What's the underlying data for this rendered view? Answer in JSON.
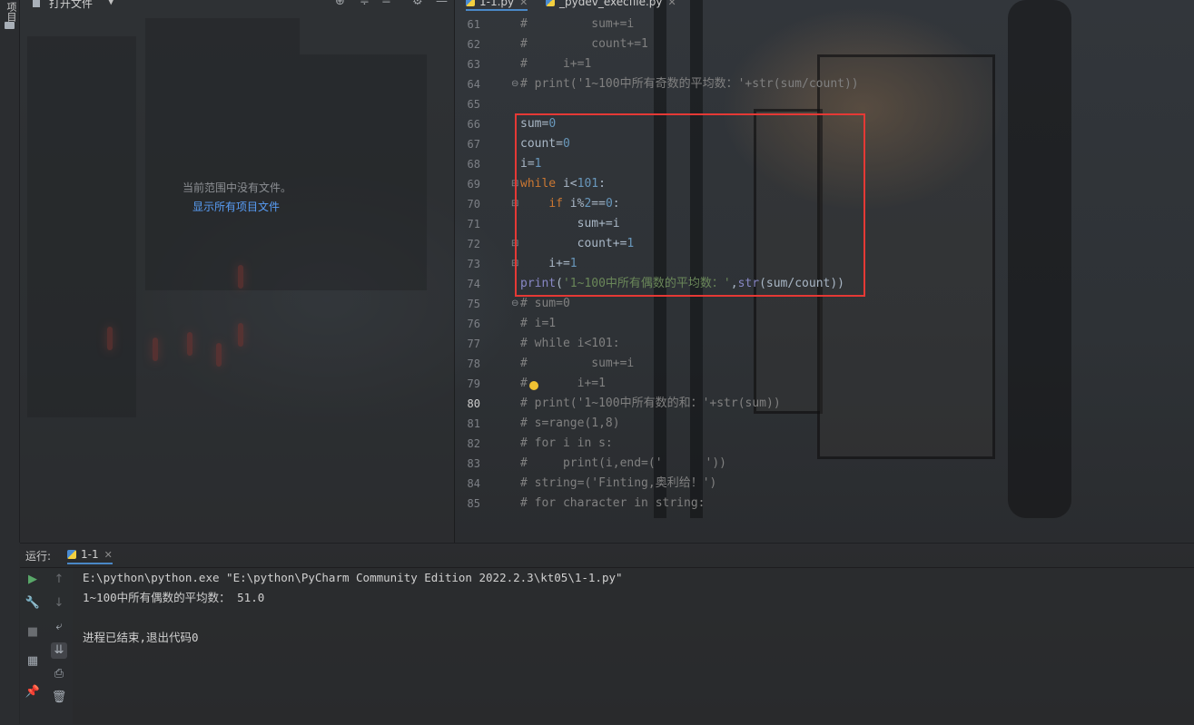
{
  "project_panel": {
    "side_label": "项目",
    "title": "打开文件",
    "empty_message": "当前范围中没有文件。",
    "show_all_link": "显示所有项目文件"
  },
  "editor": {
    "tabs": [
      {
        "label": "1-1.py",
        "active": true
      },
      {
        "label": "_pydev_execfile.py",
        "active": false
      }
    ],
    "current_line": 80,
    "line_numbers": [
      "61",
      "62",
      "63",
      "64",
      "65",
      "66",
      "67",
      "68",
      "69",
      "70",
      "71",
      "72",
      "73",
      "74",
      "75",
      "76",
      "77",
      "78",
      "79",
      "80",
      "81",
      "82",
      "83",
      "84",
      "85"
    ],
    "lines": [
      "#         sum+=i",
      "#         count+=1",
      "#     i+=1",
      "# print('1~100中所有奇数的平均数：'+str(sum/count))",
      "",
      "sum=0",
      "count=0",
      "i=1",
      "while i<101:",
      "    if i%2==0:",
      "        sum+=i",
      "        count+=1",
      "    i+=1",
      "print('1~100中所有偶数的平均数：',str(sum/count))",
      "# sum=0",
      "# i=1",
      "# while i<101:",
      "#         sum+=i",
      "#       i+=1",
      "# print('1~100中所有数的和：'+str(sum))",
      "# s=range(1,8)",
      "# for i in s:",
      "#     print(i,end=('      '))",
      "# string=('Finting,奥利给！')",
      "# for character in string:"
    ]
  },
  "run_panel": {
    "label": "运行:",
    "tab_label": "1-1",
    "output": [
      "E:\\python\\python.exe \"E:\\python\\PyCharm Community Edition 2022.2.3\\kt05\\1-1.py\"",
      "1~100中所有偶数的平均数： 51.0",
      "",
      "进程已结束,退出代码0"
    ]
  },
  "colors": {
    "highlight_box": "#e53935",
    "keyword": "#cc7832",
    "number": "#6897bb",
    "string": "#6a8759",
    "comment": "#808080"
  }
}
